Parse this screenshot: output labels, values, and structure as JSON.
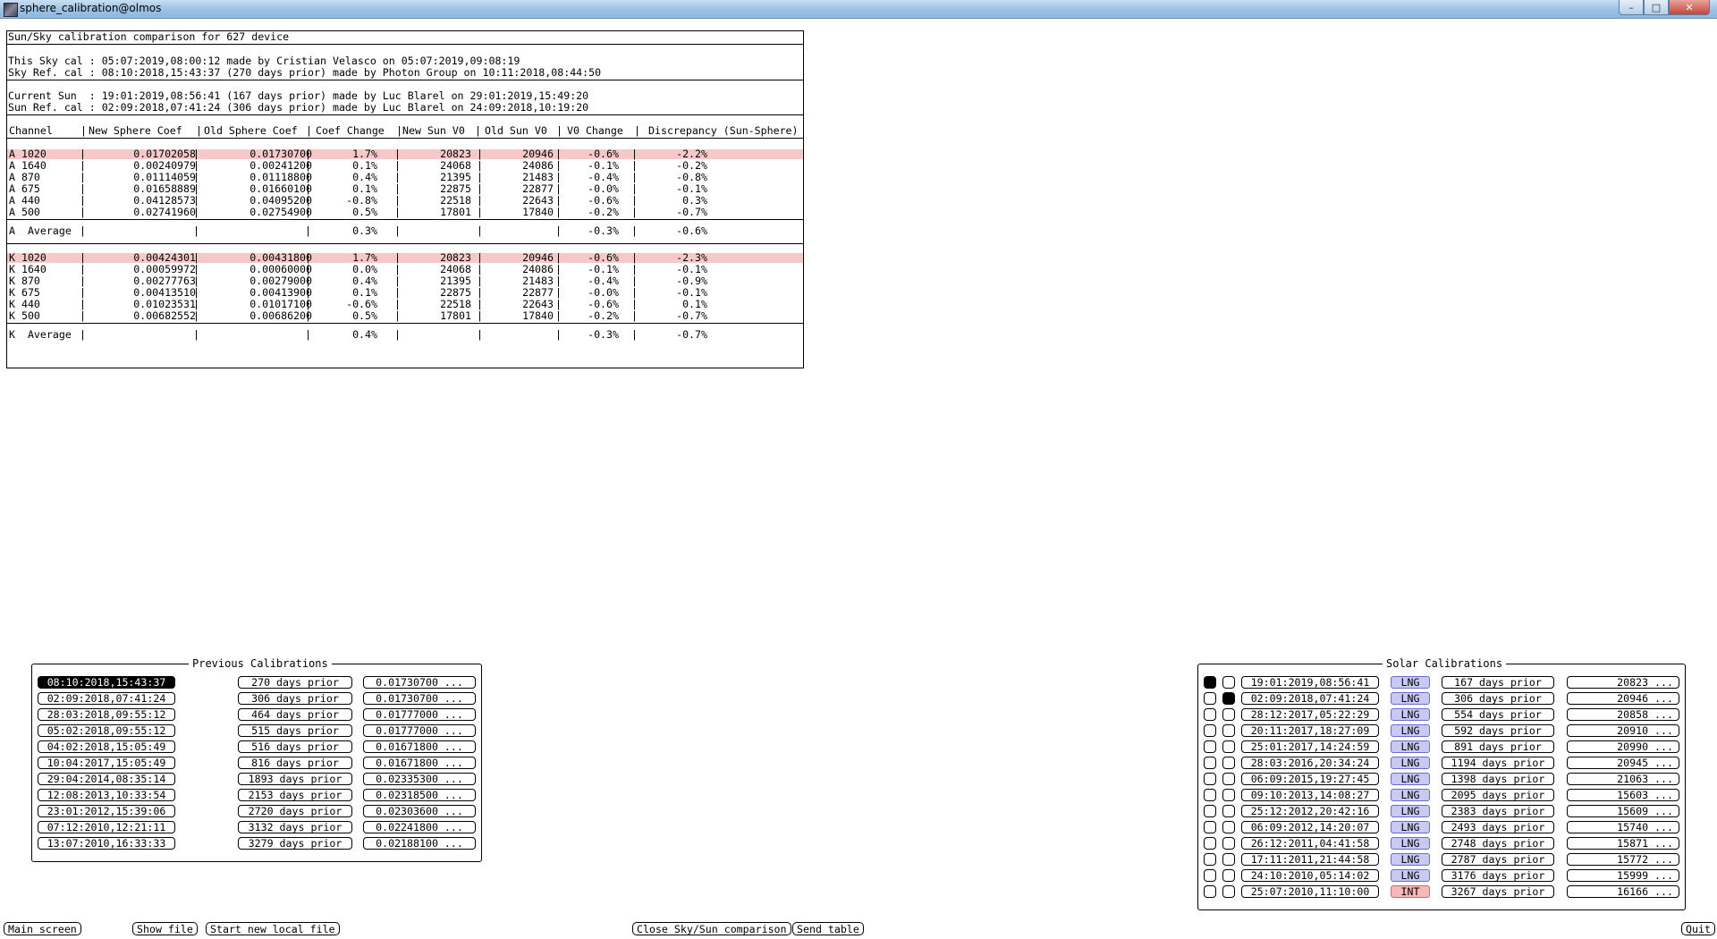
{
  "window": {
    "title": "sphere_calibration@olmos",
    "buttons": {
      "minimize": "–",
      "maximize": "□",
      "close": "✕"
    }
  },
  "report": {
    "title": "Sun/Sky calibration comparison for 627 device",
    "sky_cal": "This Sky cal : 05:07:2019,08:00:12 made by Cristian Velasco on 05:07:2019,09:08:19",
    "sky_ref_cal": "Sky Ref. cal : 08:10:2018,15:43:37 (270 days prior) made by Photon Group on 10:11:2018,08:44:50",
    "current_sun": "Current Sun  : 19:01:2019,08:56:41 (167 days prior) made by Luc Blarel on 29:01:2019,15:49:20",
    "sun_ref_cal": "Sun Ref. cal : 02:09:2018,07:41:24 (306 days prior) made by Luc Blarel on 24:09:2018,10:19:20",
    "headers": [
      "Channel",
      "New Sphere Coef",
      "Old Sphere Coef",
      "Coef Change",
      "New Sun V0",
      "Old Sun V0",
      "V0 Change",
      "Discrepancy (Sun-Sphere)"
    ],
    "a_rows": [
      [
        "A 1020",
        "0.01702058",
        "0.01730700",
        "1.7%",
        "20823",
        "20946",
        "-0.6%",
        "-2.2%"
      ],
      [
        "A 1640",
        "0.00240979",
        "0.00241200",
        "0.1%",
        "24068",
        "24086",
        "-0.1%",
        "-0.2%"
      ],
      [
        "A 870",
        "0.01114059",
        "0.01118800",
        "0.4%",
        "21395",
        "21483",
        "-0.4%",
        "-0.8%"
      ],
      [
        "A 675",
        "0.01658889",
        "0.01660100",
        "0.1%",
        "22875",
        "22877",
        "-0.0%",
        "-0.1%"
      ],
      [
        "A 440",
        "0.04128573",
        "0.04095200",
        "-0.8%",
        "22518",
        "22643",
        "-0.6%",
        "0.3%"
      ],
      [
        "A 500",
        "0.02741960",
        "0.02754900",
        "0.5%",
        "17801",
        "17840",
        "-0.2%",
        "-0.7%"
      ]
    ],
    "a_average": [
      "A  Average",
      "",
      "",
      "0.3%",
      "",
      "",
      "-0.3%",
      "-0.6%"
    ],
    "k_rows": [
      [
        "K 1020",
        "0.00424301",
        "0.00431800",
        "1.7%",
        "20823",
        "20946",
        "-0.6%",
        "-2.3%"
      ],
      [
        "K 1640",
        "0.00059972",
        "0.00060000",
        "0.0%",
        "24068",
        "24086",
        "-0.1%",
        "-0.1%"
      ],
      [
        "K 870",
        "0.00277763",
        "0.00279000",
        "0.4%",
        "21395",
        "21483",
        "-0.4%",
        "-0.9%"
      ],
      [
        "K 675",
        "0.00413510",
        "0.00413900",
        "0.1%",
        "22875",
        "22877",
        "-0.0%",
        "-0.1%"
      ],
      [
        "K 440",
        "0.01023531",
        "0.01017100",
        "-0.6%",
        "22518",
        "22643",
        "-0.6%",
        "0.1%"
      ],
      [
        "K 500",
        "0.00682552",
        "0.00686200",
        "0.5%",
        "17801",
        "17840",
        "-0.2%",
        "-0.7%"
      ]
    ],
    "k_average": [
      "K  Average",
      "",
      "",
      "0.4%",
      "",
      "",
      "-0.3%",
      "-0.7%"
    ],
    "highlight_color": "#f7c8c8"
  },
  "previous_calibrations": {
    "title": "Previous Calibrations",
    "rows": [
      {
        "date": "08:10:2018,15:43:37",
        "prior": "270 days prior",
        "coef": "0.01730700 ...",
        "selected": true
      },
      {
        "date": "02:09:2018,07:41:24",
        "prior": "306 days prior",
        "coef": "0.01730700 ...",
        "selected": false
      },
      {
        "date": "28:03:2018,09:55:12",
        "prior": "464 days prior",
        "coef": "0.01777000 ...",
        "selected": false
      },
      {
        "date": "05:02:2018,09:55:12",
        "prior": "515 days prior",
        "coef": "0.01777000 ...",
        "selected": false
      },
      {
        "date": "04:02:2018,15:05:49",
        "prior": "516 days prior",
        "coef": "0.01671800 ...",
        "selected": false
      },
      {
        "date": "10:04:2017,15:05:49",
        "prior": "816 days prior",
        "coef": "0.01671800 ...",
        "selected": false
      },
      {
        "date": "29:04:2014,08:35:14",
        "prior": "1893 days prior",
        "coef": "0.02335300 ...",
        "selected": false
      },
      {
        "date": "12:08:2013,10:33:54",
        "prior": "2153 days prior",
        "coef": "0.02318500 ...",
        "selected": false
      },
      {
        "date": "23:01:2012,15:39:06",
        "prior": "2720 days prior",
        "coef": "0.02303600 ...",
        "selected": false
      },
      {
        "date": "07:12:2010,12:21:11",
        "prior": "3132 days prior",
        "coef": "0.02241800 ...",
        "selected": false
      },
      {
        "date": "13:07:2010,16:33:33",
        "prior": "3279 days prior",
        "coef": "0.02188100 ...",
        "selected": false
      }
    ]
  },
  "solar_calibrations": {
    "title": "Solar Calibrations",
    "rows": [
      {
        "r1": true,
        "r2": false,
        "date": "19:01:2019,08:56:41",
        "type": "LNG",
        "prior": "167 days prior",
        "v0": "20823 ..."
      },
      {
        "r1": false,
        "r2": true,
        "date": "02:09:2018,07:41:24",
        "type": "LNG",
        "prior": "306 days prior",
        "v0": "20946 ..."
      },
      {
        "r1": false,
        "r2": false,
        "date": "28:12:2017,05:22:29",
        "type": "LNG",
        "prior": "554 days prior",
        "v0": "20858 ..."
      },
      {
        "r1": false,
        "r2": false,
        "date": "20:11:2017,18:27:09",
        "type": "LNG",
        "prior": "592 days prior",
        "v0": "20910 ..."
      },
      {
        "r1": false,
        "r2": false,
        "date": "25:01:2017,14:24:59",
        "type": "LNG",
        "prior": "891 days prior",
        "v0": "20990 ..."
      },
      {
        "r1": false,
        "r2": false,
        "date": "28:03:2016,20:34:24",
        "type": "LNG",
        "prior": "1194 days prior",
        "v0": "20945 ..."
      },
      {
        "r1": false,
        "r2": false,
        "date": "06:09:2015,19:27:45",
        "type": "LNG",
        "prior": "1398 days prior",
        "v0": "21063 ..."
      },
      {
        "r1": false,
        "r2": false,
        "date": "09:10:2013,14:08:27",
        "type": "LNG",
        "prior": "2095 days prior",
        "v0": "15603 ..."
      },
      {
        "r1": false,
        "r2": false,
        "date": "25:12:2012,20:42:16",
        "type": "LNG",
        "prior": "2383 days prior",
        "v0": "15609 ..."
      },
      {
        "r1": false,
        "r2": false,
        "date": "06:09:2012,14:20:07",
        "type": "LNG",
        "prior": "2493 days prior",
        "v0": "15740 ..."
      },
      {
        "r1": false,
        "r2": false,
        "date": "26:12:2011,04:41:58",
        "type": "LNG",
        "prior": "2748 days prior",
        "v0": "15871 ..."
      },
      {
        "r1": false,
        "r2": false,
        "date": "17:11:2011,21:44:58",
        "type": "LNG",
        "prior": "2787 days prior",
        "v0": "15772 ..."
      },
      {
        "r1": false,
        "r2": false,
        "date": "24:10:2010,05:14:02",
        "type": "LNG",
        "prior": "3176 days prior",
        "v0": "15999 ..."
      },
      {
        "r1": false,
        "r2": false,
        "date": "25:07:2010,11:10:00",
        "type": "INT",
        "prior": "3267 days prior",
        "v0": "16166 ..."
      }
    ]
  },
  "bottom_buttons": {
    "main_screen": "Main screen",
    "show_file": "Show file",
    "start_new_local_file": "Start new local file",
    "close_comparison": "Close Sky/Sun comparison",
    "send_table": "Send table",
    "quit": "Quit"
  }
}
